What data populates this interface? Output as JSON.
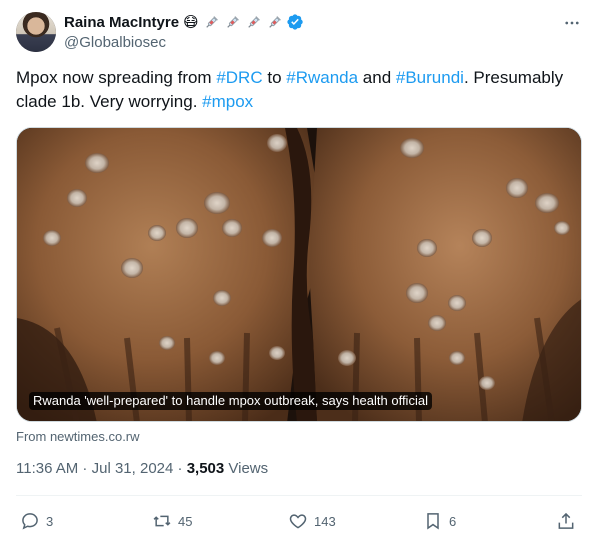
{
  "author": {
    "display_name": "Raina MacIntyre",
    "emoji_mask": "😷",
    "handle": "@Globalbiosec"
  },
  "tweet": {
    "segments": [
      {
        "text": "Mpox now spreading from ",
        "tag": false
      },
      {
        "text": "#DRC",
        "tag": true
      },
      {
        "text": " to ",
        "tag": false
      },
      {
        "text": "#Rwanda",
        "tag": true
      },
      {
        "text": " and ",
        "tag": false
      },
      {
        "text": "#Burundi",
        "tag": true
      },
      {
        "text": ". Presumably clade 1b. Very worrying. ",
        "tag": false
      },
      {
        "text": "#mpox",
        "tag": true
      }
    ]
  },
  "media": {
    "caption": "Rwanda 'well-prepared' to handle mpox outbreak, says health official"
  },
  "source": "From newtimes.co.rw",
  "meta": {
    "time": "11:36 AM",
    "separator": " · ",
    "date": "Jul 31, 2024",
    "views_count": "3,503",
    "views_label": " Views"
  },
  "actions": {
    "replies": "3",
    "reposts": "45",
    "likes": "143",
    "bookmarks": "6"
  },
  "colors": {
    "link": "#1d9bf0",
    "muted": "#536471",
    "verified": "#1d9bf0"
  },
  "icons": [
    "more-icon",
    "verified-icon",
    "syringe-icon",
    "reply-icon",
    "repost-icon",
    "like-icon",
    "bookmark-icon",
    "share-icon"
  ]
}
